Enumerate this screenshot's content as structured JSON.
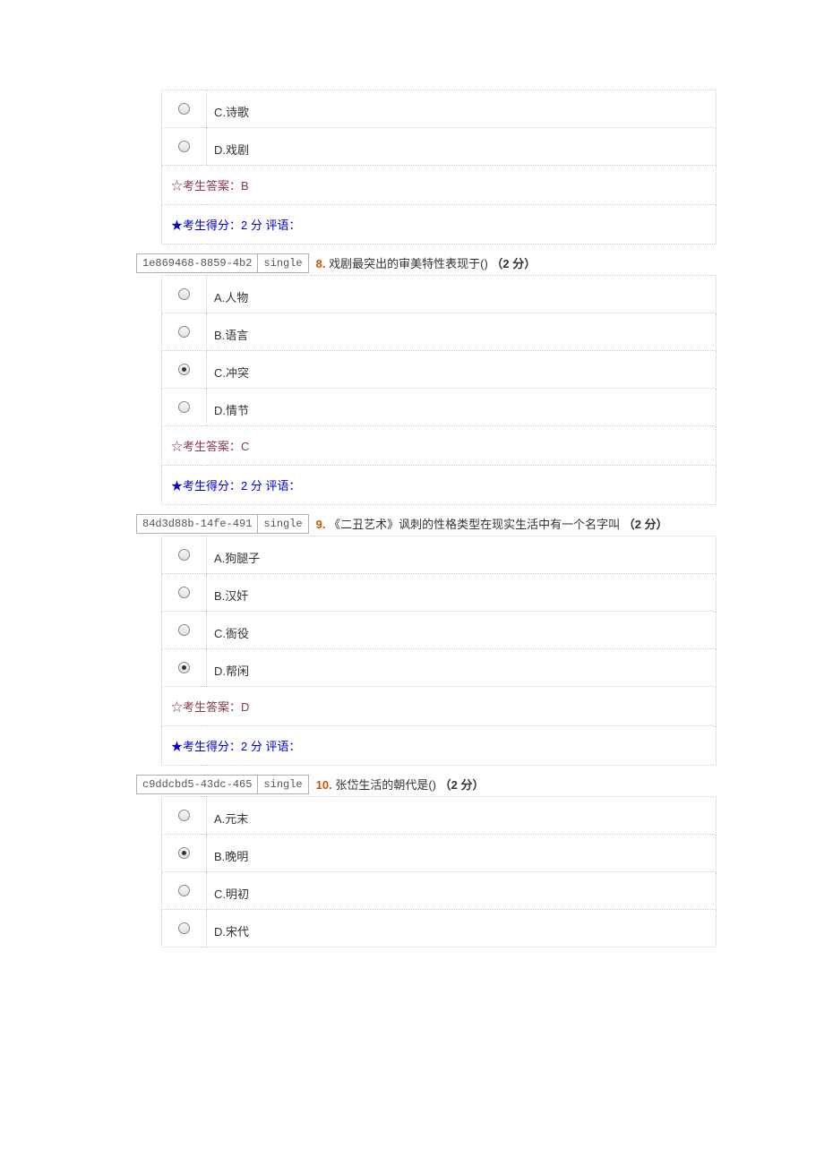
{
  "q7_tail": {
    "options": [
      {
        "label": "C.诗歌",
        "selected": false
      },
      {
        "label": "D.戏剧",
        "selected": false
      }
    ],
    "answer_label": "☆考生答案：",
    "answer_value": "B",
    "score_line": "★考生得分：2 分  评语："
  },
  "q8": {
    "meta_id": "1e869468-8859-4b2",
    "meta_type": "single",
    "num": "8.",
    "text": "戏剧最突出的审美特性表现于()",
    "points": "（2 分）",
    "options": [
      {
        "label": "A.人物",
        "selected": false
      },
      {
        "label": "B.语言",
        "selected": false
      },
      {
        "label": "C.冲突",
        "selected": true
      },
      {
        "label": "D.情节",
        "selected": false
      }
    ],
    "answer_label": "☆考生答案：",
    "answer_value": "C",
    "score_line": "★考生得分：2 分  评语："
  },
  "q9": {
    "meta_id": "84d3d88b-14fe-491",
    "meta_type": "single",
    "num": "9.",
    "text": "《二丑艺术》讽刺的性格类型在现实生活中有一个名字叫",
    "points": "（2 分）",
    "options": [
      {
        "label": "A.狗腿子",
        "selected": false
      },
      {
        "label": "B.汉奸",
        "selected": false
      },
      {
        "label": "C.衙役",
        "selected": false
      },
      {
        "label": "D.帮闲",
        "selected": true
      }
    ],
    "answer_label": "☆考生答案：",
    "answer_value": "D",
    "score_line": "★考生得分：2 分  评语："
  },
  "q10": {
    "meta_id": "c9ddcbd5-43dc-465",
    "meta_type": "single",
    "num": "10.",
    "text": "张岱生活的朝代是()",
    "points": "（2 分）",
    "options": [
      {
        "label": "A.元末",
        "selected": false
      },
      {
        "label": "B.晚明",
        "selected": true
      },
      {
        "label": "C.明初",
        "selected": false
      },
      {
        "label": "D.宋代",
        "selected": false
      }
    ]
  }
}
